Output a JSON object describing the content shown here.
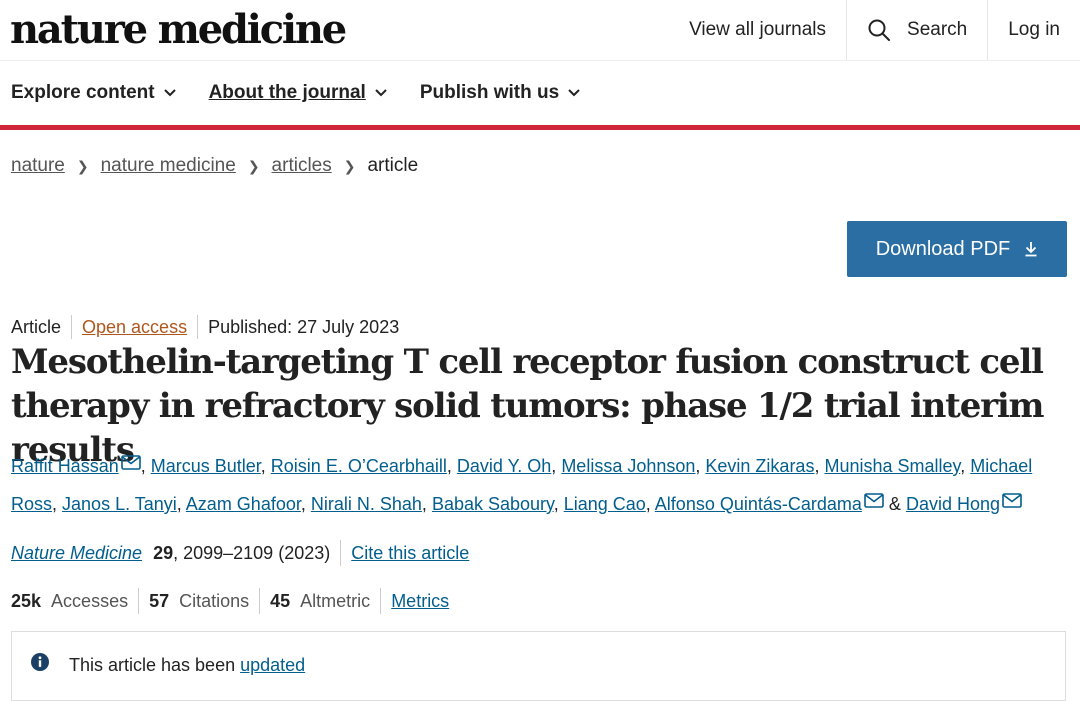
{
  "header": {
    "logo": "nature medicine",
    "links": {
      "view_all": "View all journals",
      "search": "Search",
      "login": "Log in"
    }
  },
  "nav": {
    "explore": "Explore content",
    "about": "About the journal",
    "publish": "Publish with us"
  },
  "breadcrumb": {
    "items": [
      "nature",
      "nature medicine",
      "articles"
    ],
    "current": "article"
  },
  "download_button": "Download PDF",
  "meta": {
    "type": "Article",
    "access": "Open access",
    "published": "Published: 27 July 2023"
  },
  "title": "Mesothelin-targeting T cell receptor fusion construct cell therapy in refractory solid tumors: phase 1/2 trial interim results",
  "authors": [
    "Raffit Hassan",
    "Marcus Butler",
    "Roisin E. O’Cearbhaill",
    "David Y. Oh",
    "Melissa Johnson",
    "Kevin Zikaras",
    "Munisha Smalley",
    "Michael Ross",
    "Janos L. Tanyi",
    "Azam Ghafoor",
    "Nirali N. Shah",
    "Babak Saboury",
    "Liang Cao",
    "Alfonso Quintás-Cardama",
    "David Hong"
  ],
  "authors_amp": "&",
  "citation": {
    "journal": "Nature Medicine",
    "volume": "29",
    "pages": ", 2099–2109 (2023)",
    "cite_link": "Cite this article"
  },
  "metrics": {
    "accesses_value": "25k",
    "accesses_label": "Accesses",
    "citations_value": "57",
    "citations_label": "Citations",
    "altmetric_value": "45",
    "altmetric_label": "Altmetric",
    "metrics_link": "Metrics"
  },
  "notice": {
    "text": "This article has been ",
    "link": "updated"
  },
  "colors": {
    "accent_red": "#d1253a",
    "button_blue": "#2a6ea3",
    "link_blue": "#025e8d",
    "open_access": "#b0571e"
  }
}
